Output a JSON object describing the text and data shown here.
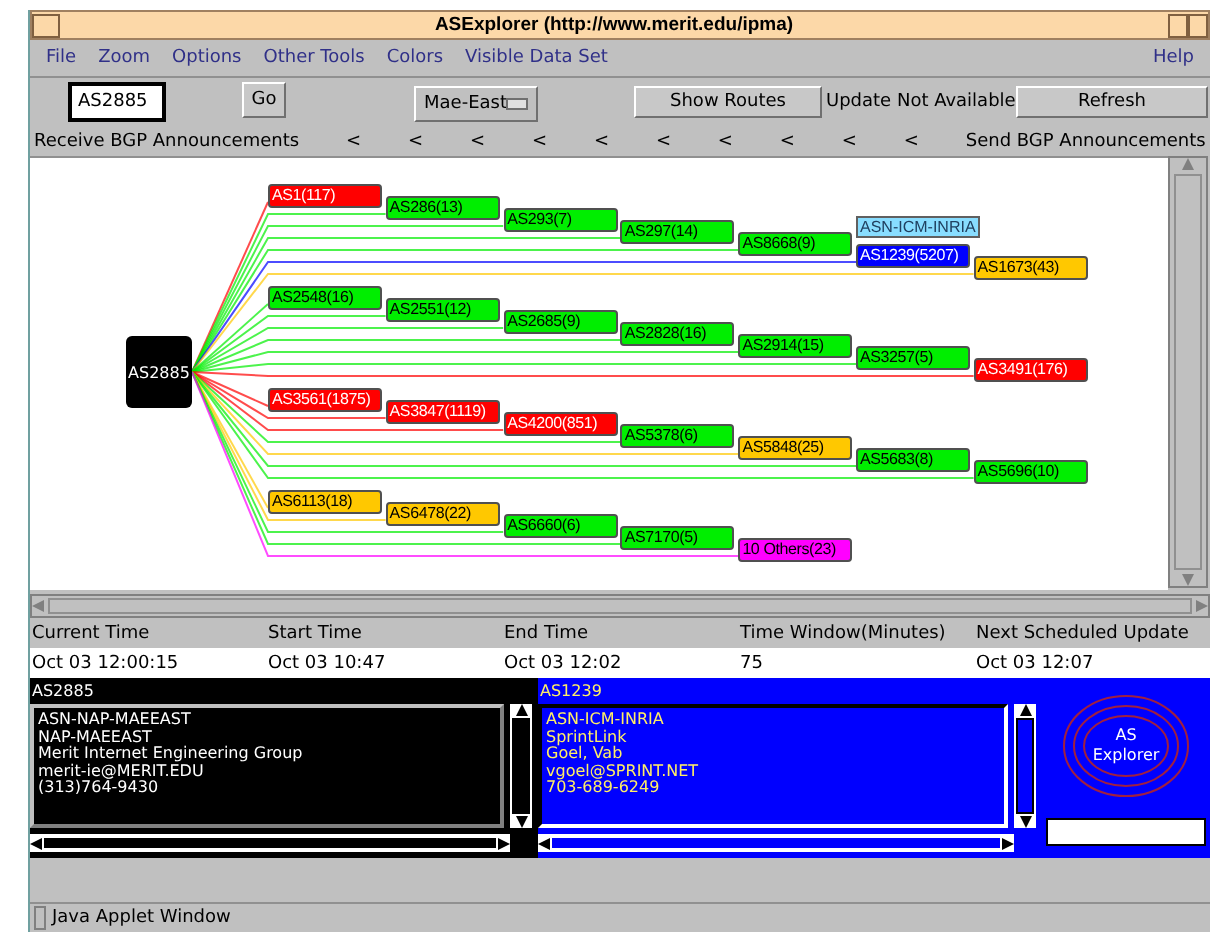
{
  "window": {
    "title": "ASExplorer (http://www.merit.edu/ipma)"
  },
  "menu": [
    {
      "label": "File"
    },
    {
      "label": "Zoom"
    },
    {
      "label": "Options"
    },
    {
      "label": "Other Tools"
    },
    {
      "label": "Colors"
    },
    {
      "label": "Visible Data Set"
    }
  ],
  "help_menu": {
    "label": "Help"
  },
  "toolbar": {
    "as_field": {
      "value": "AS2885"
    },
    "go": "Go",
    "exchange": {
      "value": "Mae-East"
    },
    "show_routes": "Show Routes",
    "update_status": "Update Not Available",
    "refresh": "Refresh"
  },
  "direction_bar": {
    "receive": "Receive BGP Announcements",
    "marks": [
      "<",
      "<",
      "<",
      "<",
      "<",
      "<",
      "<",
      "<",
      "<",
      "<"
    ],
    "send": "Send BGP Announcements"
  },
  "graph": {
    "root": "AS2885",
    "groups": [
      {
        "nodes": [
          {
            "label": "AS1(117)",
            "color": "#ff0000"
          },
          {
            "label": "AS286(13)",
            "color": "#00ee00"
          },
          {
            "label": "AS293(7)",
            "color": "#00ee00"
          },
          {
            "label": "AS297(14)",
            "color": "#00ee00"
          },
          {
            "label": "AS8668(9)",
            "color": "#00ee00"
          },
          {
            "label": "AS1239(5207)",
            "color": "#0000ff",
            "tag": "ASN-ICM-INRIA"
          },
          {
            "label": "AS1673(43)",
            "color": "#ffc800"
          }
        ]
      },
      {
        "nodes": [
          {
            "label": "AS2548(16)",
            "color": "#00ee00"
          },
          {
            "label": "AS2551(12)",
            "color": "#00ee00"
          },
          {
            "label": "AS2685(9)",
            "color": "#00ee00"
          },
          {
            "label": "AS2828(16)",
            "color": "#00ee00"
          },
          {
            "label": "AS2914(15)",
            "color": "#00ee00"
          },
          {
            "label": "AS3257(5)",
            "color": "#00ee00"
          },
          {
            "label": "AS3491(176)",
            "color": "#ff0000"
          }
        ]
      },
      {
        "nodes": [
          {
            "label": "AS3561(1875)",
            "color": "#ff0000"
          },
          {
            "label": "AS3847(1119)",
            "color": "#ff0000"
          },
          {
            "label": "AS4200(851)",
            "color": "#ff0000"
          },
          {
            "label": "AS5378(6)",
            "color": "#00ee00"
          },
          {
            "label": "AS5848(25)",
            "color": "#ffc800"
          },
          {
            "label": "AS5683(8)",
            "color": "#00ee00"
          },
          {
            "label": "AS5696(10)",
            "color": "#00ee00"
          }
        ]
      },
      {
        "nodes": [
          {
            "label": "AS6113(18)",
            "color": "#ffc800"
          },
          {
            "label": "AS6478(22)",
            "color": "#ffc800"
          },
          {
            "label": "AS6660(6)",
            "color": "#00ee00"
          },
          {
            "label": "AS7170(5)",
            "color": "#00ee00"
          },
          {
            "label": "10 Others(23)",
            "color": "#ff00ff"
          }
        ]
      }
    ]
  },
  "times": {
    "columns": [
      "Current Time",
      "Start Time",
      "End Time",
      "Time Window(Minutes)",
      "Next Scheduled Update"
    ],
    "values": [
      "Oct 03 12:00:15",
      "Oct 03 10:47",
      "Oct 03 12:02",
      "75",
      "Oct 03 12:07"
    ]
  },
  "panels": [
    {
      "kind": "dark",
      "title": "AS2885",
      "lines": [
        "ASN-NAP-MAEEAST",
        "NAP-MAEEAST",
        "Merit Internet Engineering Group",
        "merit-ie@MERIT.EDU",
        "(313)764-9430"
      ]
    },
    {
      "kind": "blue",
      "title": "AS1239",
      "lines": [
        "ASN-ICM-INRIA",
        "SprintLink",
        "Goel, Vab",
        "vgoel@SPRINT.NET",
        "703-689-6249"
      ]
    }
  ],
  "logo": {
    "lines": [
      "AS",
      "Explorer"
    ]
  },
  "status_bar": {
    "text": "Java Applet Window"
  }
}
